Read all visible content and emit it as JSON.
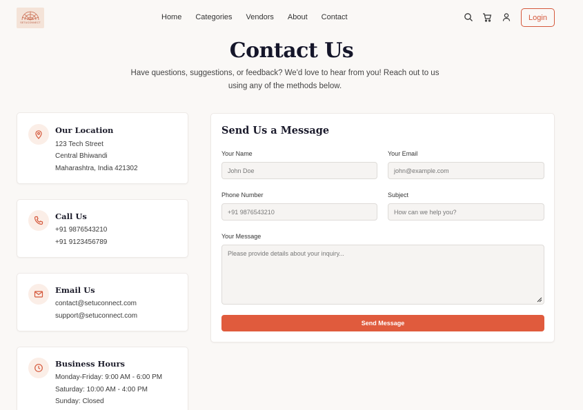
{
  "header": {
    "logo_text": "SETUCONNECT",
    "nav": [
      "Home",
      "Categories",
      "Vendors",
      "About",
      "Contact"
    ],
    "icons": [
      "search-icon",
      "cart-icon",
      "user-icon"
    ],
    "login_label": "Login",
    "accent": "#d4573a"
  },
  "hero": {
    "title": "Contact Us",
    "subtitle_line1": "Have questions, suggestions, or feedback? We'd love to hear from you! Reach out to us",
    "subtitle_line2": "using any of the methods below."
  },
  "cards": {
    "location": {
      "icon": "map-pin-icon",
      "title": "Our Location",
      "lines": [
        "123 Tech Street",
        "Central Bhiwandi",
        "Maharashtra, India 421302"
      ]
    },
    "call": {
      "icon": "phone-icon",
      "title": "Call Us",
      "lines": [
        "+91 9876543210",
        "+91 9123456789"
      ]
    },
    "email": {
      "icon": "mail-icon",
      "title": "Email Us",
      "lines": [
        "contact@setuconnect.com",
        "support@setuconnect.com"
      ]
    },
    "hours": {
      "icon": "clock-icon",
      "title": "Business Hours",
      "lines": [
        "Monday-Friday: 9:00 AM - 6:00 PM",
        "Saturday: 10:00 AM - 4:00 PM",
        "Sunday: Closed"
      ]
    }
  },
  "form": {
    "title": "Send Us a Message",
    "name_label": "Your Name",
    "name_placeholder": "John Doe",
    "email_label": "Your Email",
    "email_placeholder": "john@example.com",
    "phone_label": "Phone Number",
    "phone_placeholder": "+91 9876543210",
    "subject_label": "Subject",
    "subject_placeholder": "How can we help you?",
    "message_label": "Your Message",
    "message_placeholder": "Please provide details about your inquiry...",
    "submit_label": "Send Message",
    "button_color": "#e05b3d"
  }
}
